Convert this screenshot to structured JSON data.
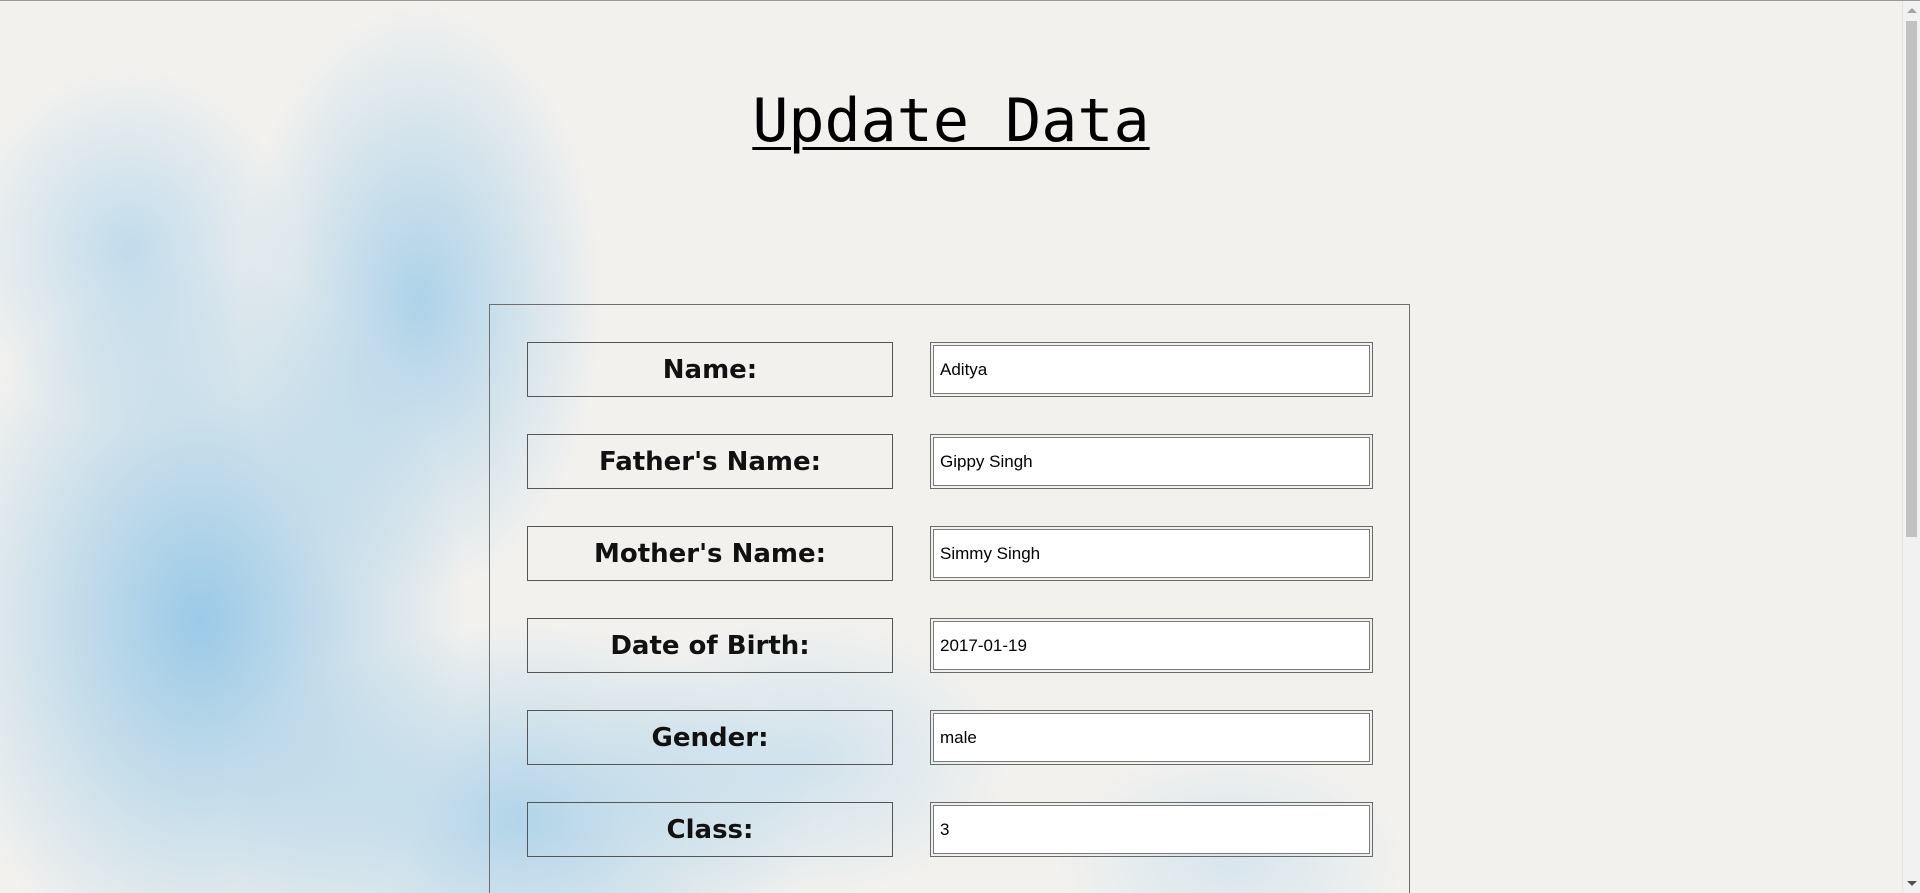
{
  "page": {
    "title": "Update Data"
  },
  "form": {
    "fields": [
      {
        "label": "Name:",
        "value": "Aditya"
      },
      {
        "label": "Father's Name:",
        "value": "Gippy Singh"
      },
      {
        "label": "Mother's Name:",
        "value": "Simmy Singh"
      },
      {
        "label": "Date of Birth:",
        "value": "2017-01-19"
      },
      {
        "label": "Gender:",
        "value": "male"
      },
      {
        "label": "Class:",
        "value": "3"
      }
    ]
  },
  "colors": {
    "background": "#f1f0ed",
    "watercolor_accent": "#8cc3e6",
    "text": "#000000",
    "border": "#555555"
  }
}
